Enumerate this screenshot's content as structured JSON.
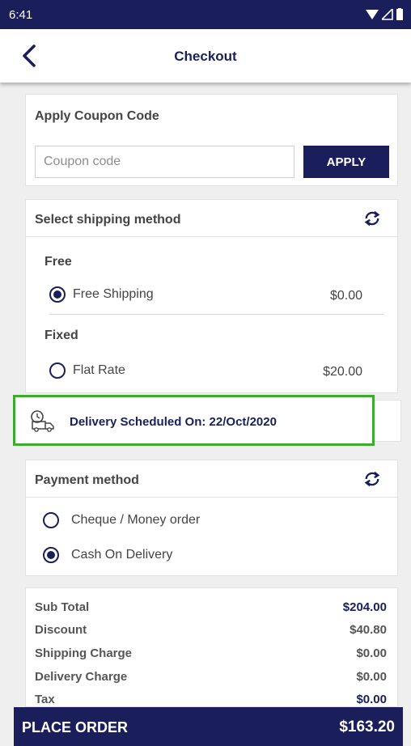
{
  "status_bar": {
    "time": "6:41"
  },
  "header": {
    "title": "Checkout"
  },
  "coupon": {
    "heading": "Apply Coupon Code",
    "placeholder": "Coupon code",
    "apply_label": "APPLY"
  },
  "shipping": {
    "heading": "Select shipping method",
    "groups": [
      {
        "label": "Free",
        "option": "Free Shipping",
        "price": "$0.00",
        "selected": true
      },
      {
        "label": "Fixed",
        "option": "Flat Rate",
        "price": "$20.00",
        "selected": false
      }
    ]
  },
  "delivery": {
    "text": "Delivery Scheduled On: 22/Oct/2020"
  },
  "payment": {
    "heading": "Payment method",
    "options": [
      {
        "label": "Cheque / Money order",
        "selected": false
      },
      {
        "label": "Cash On Delivery",
        "selected": true
      }
    ]
  },
  "summary": [
    {
      "label": "Sub Total",
      "value": "$204.00"
    },
    {
      "label": "Discount",
      "value": "$40.80"
    },
    {
      "label": "Shipping Charge",
      "value": "$0.00"
    },
    {
      "label": "Delivery Charge",
      "value": "$0.00"
    },
    {
      "label": "Tax",
      "value": "$0.00"
    }
  ],
  "place_order": {
    "label": "PLACE ORDER",
    "total": "$163.20"
  },
  "colors": {
    "primary": "#1a1f5c",
    "highlight": "#3cac2f",
    "background": "#efefef"
  }
}
